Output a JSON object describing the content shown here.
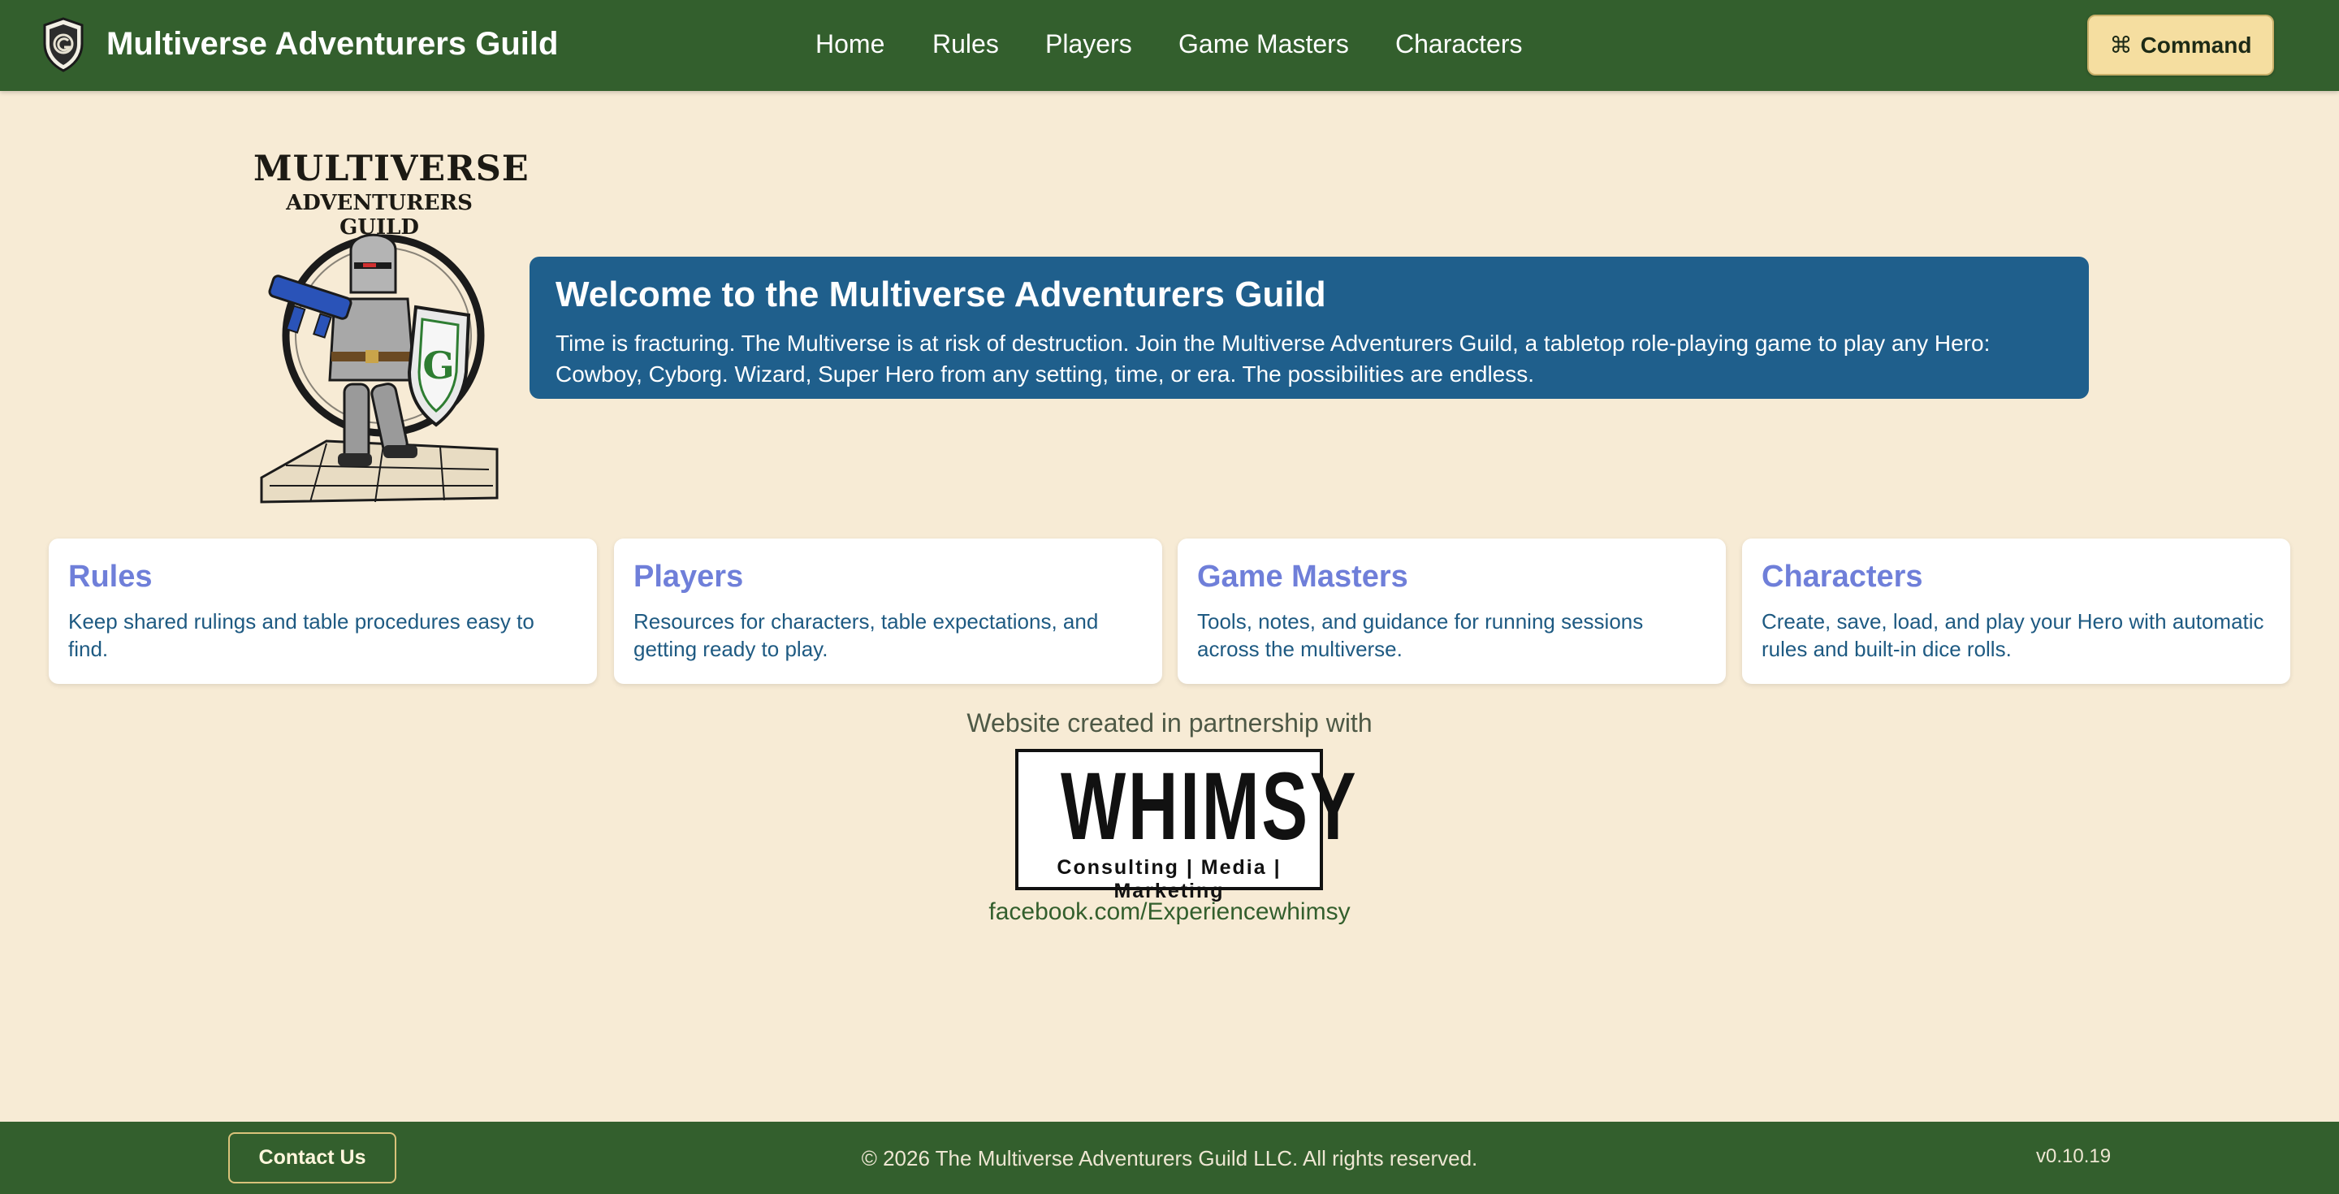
{
  "header": {
    "title": "Multiverse Adventurers Guild",
    "logo_icon": "guild-shield-icon",
    "nav": [
      "Home",
      "Rules",
      "Players",
      "Game Masters",
      "Characters"
    ],
    "command_symbol": "⌘",
    "command_label": "Command"
  },
  "hero": {
    "logo_line1": "MULTIVERSE",
    "logo_line2": "ADVENTURERS GUILD",
    "logo_image": "armored-knight-with-blaster-and-shield",
    "welcome_title": "Welcome to the Multiverse Adventurers Guild",
    "welcome_body": "Time is fracturing. The Multiverse is at risk of destruction. Join the Multiverse Adventurers Guild, a tabletop role-playing game to play any Hero: Cowboy, Cyborg. Wizard, Super Hero from any setting, time, or era. The possibilities are endless."
  },
  "cards": [
    {
      "title": "Rules",
      "description": "Keep shared rulings and table procedures easy to find."
    },
    {
      "title": "Players",
      "description": "Resources for characters, table expectations, and getting ready to play."
    },
    {
      "title": "Game Masters",
      "description": "Tools, notes, and guidance for running sessions across the multiverse."
    },
    {
      "title": "Characters",
      "description": "Create, save, load, and play your Hero with automatic rules and built-in dice rolls."
    }
  ],
  "partner": {
    "caption": "Website created in partnership with",
    "logo_word": "WHIMSY",
    "logo_tagline": "Consulting | Media | Marketing",
    "link": "facebook.com/Experiencewhimsy"
  },
  "footer": {
    "contact_label": "Contact Us",
    "copyright": "© 2026 The Multiverse Adventurers Guild LLC. All rights reserved.",
    "version": "v0.10.19"
  },
  "colors": {
    "header_bg": "#335f2d",
    "page_bg": "#f7ebd5",
    "welcome_bg": "#1f5f8c",
    "card_title": "#6f7fd9",
    "card_text": "#1e5a82",
    "command_bg": "#f5dea0"
  }
}
